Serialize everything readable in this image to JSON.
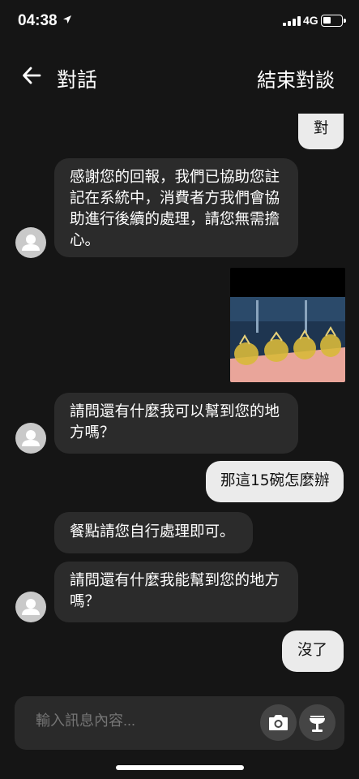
{
  "status_bar": {
    "time": "04:38",
    "network": "4G"
  },
  "header": {
    "title": "對話",
    "end_label": "結束對談"
  },
  "messages": [
    {
      "side": "out",
      "text": "對"
    },
    {
      "side": "in",
      "lines": [
        "感謝您的回報，我們已協助您註",
        "記在系統中，消費者方我們會協",
        "助進行後續的處理，請您無需擔",
        "心。"
      ]
    },
    {
      "side": "out",
      "type": "photo"
    },
    {
      "side": "in",
      "lines": [
        "請問還有什麼我可以幫到您的地",
        "方嗎？"
      ]
    },
    {
      "side": "out",
      "text": "那這15碗怎麼辦"
    },
    {
      "side": "in",
      "lines": [
        "餐點請您自行處理即可。"
      ]
    },
    {
      "side": "in",
      "lines": [
        "請問還有什麼我能幫到您的地方",
        "嗎？"
      ]
    },
    {
      "side": "out",
      "text": "沒了"
    }
  ],
  "composer": {
    "placeholder": "輸入訊息內容..."
  },
  "colors": {
    "background": "#151515",
    "incoming_bubble": "#2b2b2b",
    "outgoing_bubble": "#ebebeb"
  }
}
